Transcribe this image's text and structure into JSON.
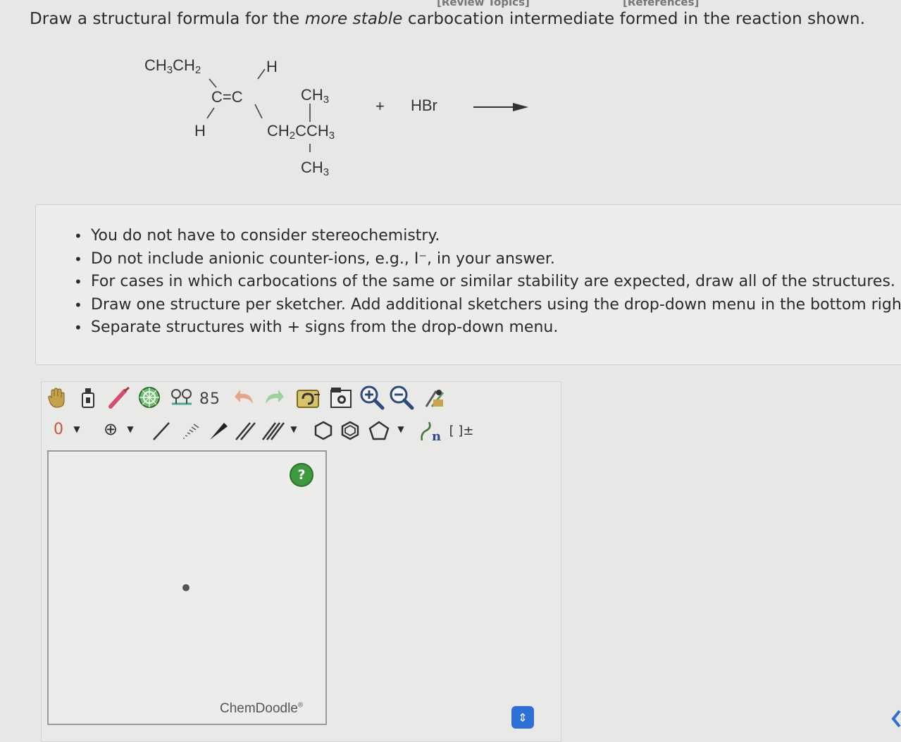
{
  "header": {
    "review_topics": "[Review Topics]",
    "references": "[References]"
  },
  "question": {
    "prefix": "Draw a structural formula for the ",
    "emphasis": "more stable",
    "suffix": " carbocation intermediate formed in the reaction shown."
  },
  "reaction": {
    "ethyl": "CH3CH2",
    "h_top": "H",
    "double_bond": "C=C",
    "h_bottom": "H",
    "ch3_top": "CH3",
    "chain": "CH2CCH3",
    "ch3_bottom": "CH3",
    "plus": "+",
    "reagent": "HBr"
  },
  "instructions": [
    "You do not have to consider stereochemistry.",
    "Do not include anionic counter-ions, e.g., I⁻, in your answer.",
    "For cases in which carbocations of the same or similar stability are expected, draw all of the structures.",
    "Draw one structure per sketcher. Add additional sketchers using the drop-down menu in the bottom righ",
    "Separate structures with + signs from the drop-down menu."
  ],
  "toolbar": {
    "row1_icons": [
      "hand-icon",
      "eraser-bottle-icon",
      "lasso-icon",
      "ring-template-icon",
      "clean-icon",
      "atom-map-icon",
      "undo-icon",
      "redo-icon",
      "copy-icon",
      "paste-icon",
      "zoom-in-icon",
      "zoom-out-icon",
      "settings-icon"
    ],
    "charge_label": "0",
    "plus_charge_label": "⊕",
    "sgroup_label": "n",
    "bracket_label": "[ ]±"
  },
  "sketcher": {
    "help_label": "?",
    "brand": "ChemDoodle",
    "brand_mark": "®"
  },
  "dropdown_button_label": "⇕",
  "colors": {
    "help_green": "#3d9a3d",
    "dropdown_blue": "#2f6fd8"
  }
}
